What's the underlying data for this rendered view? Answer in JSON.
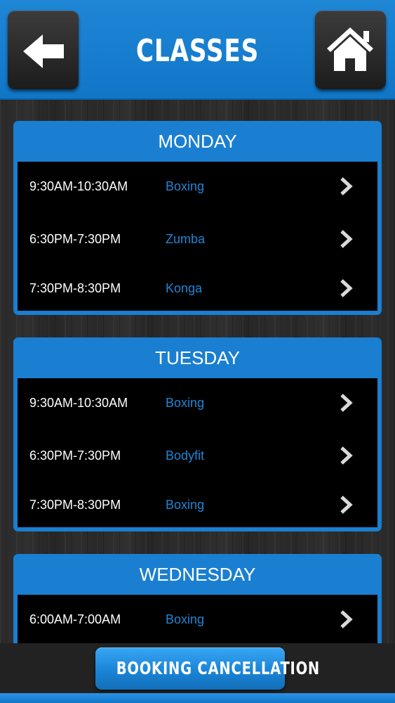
{
  "header": {
    "title": "CLASSES",
    "back_icon": "back-arrow-icon",
    "home_icon": "home-icon"
  },
  "colors": {
    "accent_blue": "#1a7fd1",
    "class_name_blue": "#1f86d6",
    "list_background": "#000000"
  },
  "schedule": [
    {
      "day": "MONDAY",
      "sessions": [
        {
          "time": "9:30AM-10:30AM",
          "class": "Boxing"
        },
        {
          "time": "6:30PM-7:30PM",
          "class": "Zumba"
        },
        {
          "time": "7:30PM-8:30PM",
          "class": "Konga"
        }
      ]
    },
    {
      "day": "TUESDAY",
      "sessions": [
        {
          "time": "9:30AM-10:30AM",
          "class": "Boxing"
        },
        {
          "time": "6:30PM-7:30PM",
          "class": "Bodyfit"
        },
        {
          "time": "7:30PM-8:30PM",
          "class": "Boxing"
        }
      ]
    },
    {
      "day": "WEDNESDAY",
      "sessions": [
        {
          "time": "6:00AM-7:00AM",
          "class": "Boxing"
        }
      ]
    }
  ],
  "footer": {
    "booking_cancellation_label": "BOOKING CANCELLATION"
  }
}
